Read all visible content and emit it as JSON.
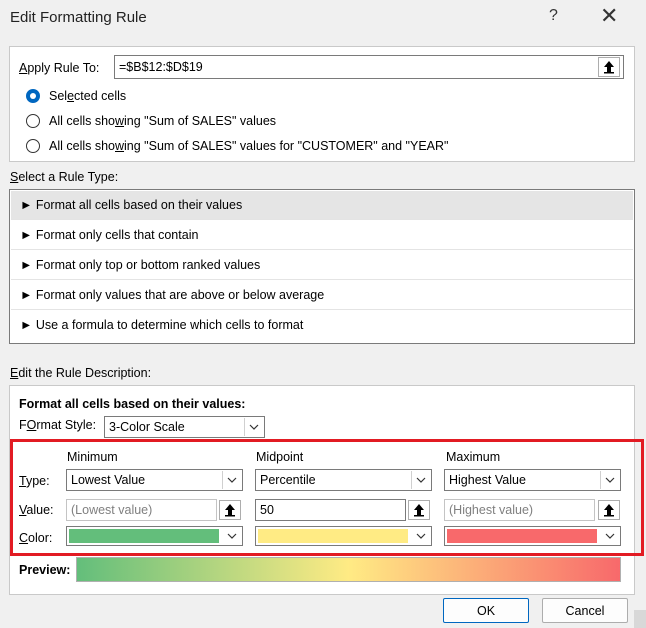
{
  "window": {
    "title": "Edit Formatting Rule",
    "help": "?",
    "close": "✕"
  },
  "apply_rule": {
    "label_pre": "",
    "label_u": "A",
    "label_post": "pply Rule To:",
    "value": "=$B$12:$D$19",
    "options": [
      {
        "pre": "Sel",
        "u": "e",
        "post": "cted cells",
        "selected": true
      },
      {
        "pre": "All cells sho",
        "u": "w",
        "post": "ing \"Sum of SALES\" values",
        "selected": false
      },
      {
        "pre": "All cells sho",
        "u": "w",
        "post": "ing \"Sum of SALES\" values for \"CUSTOMER\" and \"YEAR\"",
        "selected": false
      }
    ]
  },
  "rule_type": {
    "heading_u": "S",
    "heading_post": "elect a Rule Type:",
    "items": [
      "► Format all cells based on their values",
      "► Format only cells that contain",
      "► Format only top or bottom ranked values",
      "► Format only values that are above or below average",
      "► Use a formula to determine which cells to format"
    ]
  },
  "description": {
    "heading_u": "E",
    "heading_post": "dit the Rule Description:",
    "bold_title": "Format all cells based on their values:",
    "format_style_u": "O",
    "format_style_pre": "F",
    "format_style_post": "rmat Style:",
    "format_style_value": "3-Color Scale",
    "columns": [
      "Minimum",
      "Midpoint",
      "Maximum"
    ],
    "type_label_u": "T",
    "type_label_post": "ype:",
    "value_label_u": "V",
    "value_label_post": "alue:",
    "color_label_u": "C",
    "color_label_post": "olor:",
    "types": [
      "Lowest Value",
      "Percentile",
      "Highest Value"
    ],
    "values": [
      "(Lowest value)",
      "50",
      "(Highest value)"
    ],
    "colors": [
      "#63be7b",
      "#ffeb84",
      "#f8696b"
    ],
    "preview_label": "Preview:"
  },
  "buttons": {
    "ok": "OK",
    "cancel": "Cancel"
  }
}
